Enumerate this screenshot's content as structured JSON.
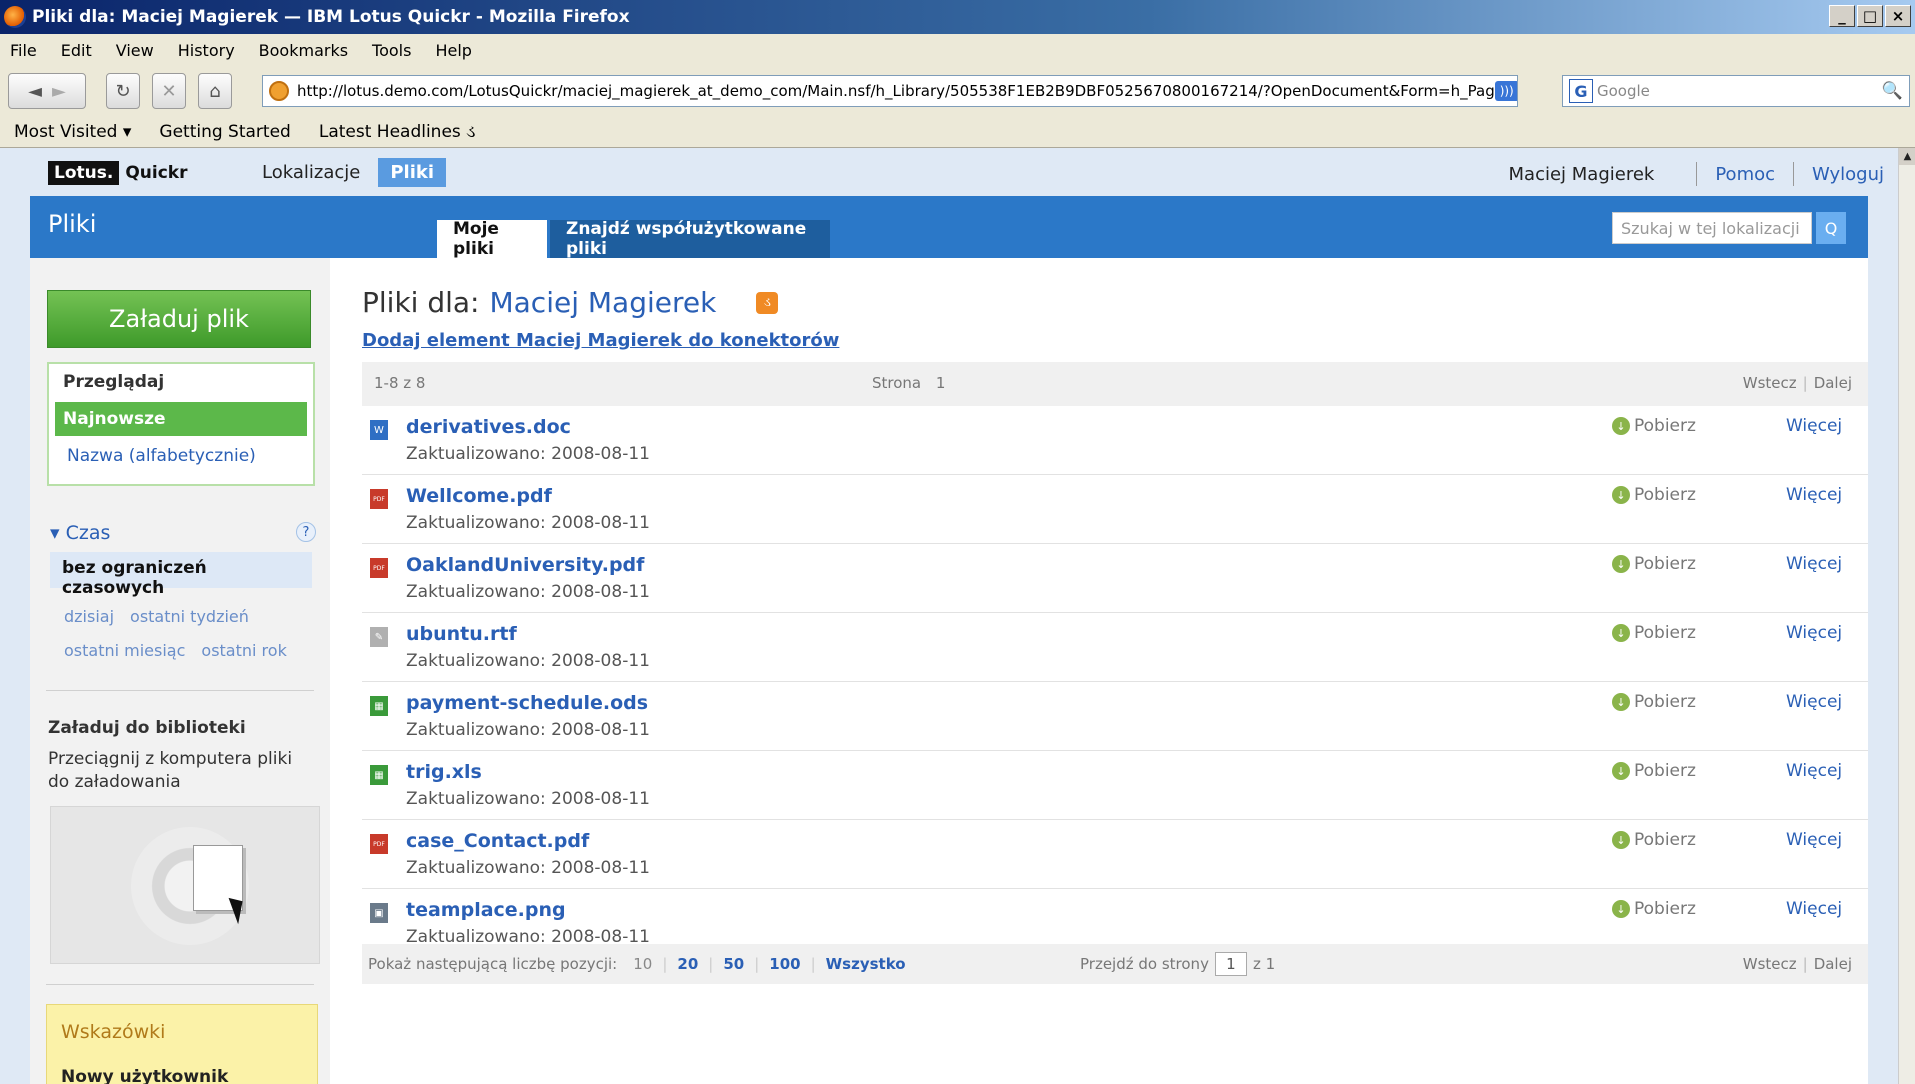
{
  "window": {
    "title": "Pliki dla: Maciej Magierek — IBM Lotus Quickr - Mozilla Firefox",
    "buttons": [
      "_",
      "□",
      "×"
    ]
  },
  "menu": [
    "File",
    "Edit",
    "View",
    "History",
    "Bookmarks",
    "Tools",
    "Help"
  ],
  "nav": {
    "back": "◄",
    "forward": "►",
    "reload": "↻",
    "stop": "✕",
    "home": "⌂",
    "url": "http://lotus.demo.com/LotusQuickr/maciej_magierek_at_demo_com/Main.nsf/h_Library/505538F1EB2B9DBF0525670800167214/?OpenDocument&Form=h_Pag",
    "star": "☆",
    "dropdown": "▼",
    "search_engine": "G",
    "search_placeholder": "Google",
    "search_icon": "🔍"
  },
  "bookmarks": [
    "Most Visited ▾",
    "Getting Started",
    "Latest Headlines ડ"
  ],
  "app": {
    "logo_lotus": "Lotus.",
    "logo_quickr": "Quickr",
    "nav_places": "Lokalizacje",
    "nav_files": "Pliki",
    "user": "Maciej Magierek",
    "help": "Pomoc",
    "logout": "Wyloguj"
  },
  "banner": {
    "title": "Pliki",
    "tab_my_files": "Moje pliki",
    "tab_shared": "Znajdź współużytkowane pliki",
    "search_placeholder": "Szukaj w tej lokalizacji",
    "search_button": "Q"
  },
  "sidebar": {
    "upload_button": "Załaduj plik",
    "browse_heading": "Przeglądaj",
    "browse_selected": "Najnowsze",
    "browse_alt": "Nazwa (alfabetycznie)",
    "time_heading": "▾ Czas",
    "help_icon": "?",
    "time_selected": "bez ograniczeń czasowych",
    "time_links_1": [
      "dzisiaj",
      "ostatni tydzień"
    ],
    "time_links_2": [
      "ostatni miesiąc",
      "ostatni rok"
    ],
    "library_heading": "Załaduj do biblioteki",
    "library_text": "Przeciągnij z komputera pliki do załadowania",
    "tips_heading": "Wskazówki",
    "tips_item": "Nowy użytkownik"
  },
  "main": {
    "heading_prefix": "Pliki dla:",
    "heading_owner": "Maciej Magierek",
    "rss_icon": "ડ",
    "add_link": "Dodaj element Maciej Magierek do konektorów",
    "count": "1-8 z 8",
    "page_label": "Strona",
    "page_num": "1",
    "prev": "Wstecz",
    "next": "Dalej",
    "download_label": "Pobierz",
    "more_label": "Więcej",
    "files": [
      {
        "name": "derivatives.doc",
        "updated": "Zaktualizowano: 2008-08-11",
        "icon": "doc-icon",
        "color": "#2f6fc4",
        "glyph": "W"
      },
      {
        "name": "Wellcome.pdf",
        "updated": "Zaktualizowano: 2008-08-11",
        "icon": "pdf-icon",
        "color": "#c83a2a",
        "glyph": "PDF"
      },
      {
        "name": "OaklandUniversity.pdf",
        "updated": "Zaktualizowano: 2008-08-11",
        "icon": "pdf-icon",
        "color": "#c83a2a",
        "glyph": "PDF"
      },
      {
        "name": "ubuntu.rtf",
        "updated": "Zaktualizowano: 2008-08-11",
        "icon": "rtf-icon",
        "color": "#b0b0b0",
        "glyph": "✎"
      },
      {
        "name": "payment-schedule.ods",
        "updated": "Zaktualizowano: 2008-08-11",
        "icon": "spreadsheet-icon",
        "color": "#3a9a3a",
        "glyph": "▦"
      },
      {
        "name": "trig.xls",
        "updated": "Zaktualizowano: 2008-08-11",
        "icon": "spreadsheet-icon",
        "color": "#3a9a3a",
        "glyph": "▦"
      },
      {
        "name": "case_Contact.pdf",
        "updated": "Zaktualizowano: 2008-08-11",
        "icon": "pdf-icon",
        "color": "#c83a2a",
        "glyph": "PDF"
      },
      {
        "name": "teamplace.png",
        "updated": "Zaktualizowano: 2008-08-11",
        "icon": "image-icon",
        "color": "#6a7a8a",
        "glyph": "▣"
      }
    ],
    "footer_label": "Pokaż następującą liczbę pozycji:",
    "footer_sizes": [
      "10",
      "20",
      "50",
      "100",
      "Wszystko"
    ],
    "goto_label": "Przejdź do strony",
    "goto_value": "1",
    "goto_total": "z 1"
  },
  "colors": {
    "accent": "#2b78c8",
    "link": "#2a5fb5",
    "upload_green": "#5cb84a",
    "tips_bg": "#fbf2a8"
  }
}
